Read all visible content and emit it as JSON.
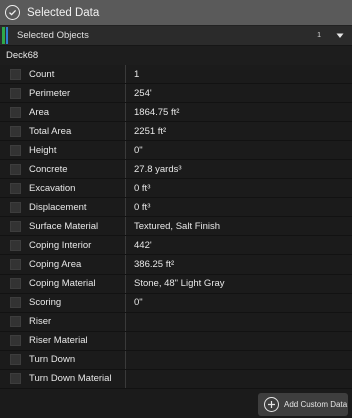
{
  "header": {
    "title": "Selected Data",
    "icon": "check-circle-icon"
  },
  "selector": {
    "label": "Selected Objects",
    "count": "1",
    "icon": "chevron-down-icon",
    "accent_green": "#2ea84a",
    "accent_blue": "#2f7fd1"
  },
  "object": {
    "name": "Deck68"
  },
  "rows": [
    {
      "label": "Count",
      "value": "1"
    },
    {
      "label": "Perimeter",
      "value": "254'"
    },
    {
      "label": "Area",
      "value": "1864.75 ft²"
    },
    {
      "label": "Total Area",
      "value": "2251 ft²"
    },
    {
      "label": "Height",
      "value": "0\""
    },
    {
      "label": "Concrete",
      "value": "27.8 yards³"
    },
    {
      "label": "Excavation",
      "value": "0 ft³"
    },
    {
      "label": "Displacement",
      "value": "0 ft³"
    },
    {
      "label": "Surface Material",
      "value": "Textured, Salt Finish"
    },
    {
      "label": "Coping Interior",
      "value": "442'"
    },
    {
      "label": "Coping Area",
      "value": "386.25 ft²"
    },
    {
      "label": "Coping Material",
      "value": "Stone, 48\" Light Gray"
    },
    {
      "label": "Scoring",
      "value": "0\""
    },
    {
      "label": "Riser",
      "value": ""
    },
    {
      "label": "Riser Material",
      "value": ""
    },
    {
      "label": "Turn Down",
      "value": ""
    },
    {
      "label": "Turn Down Material",
      "value": ""
    }
  ],
  "footer": {
    "add_label": "Add Custom Data",
    "icon": "plus-circle-icon"
  }
}
